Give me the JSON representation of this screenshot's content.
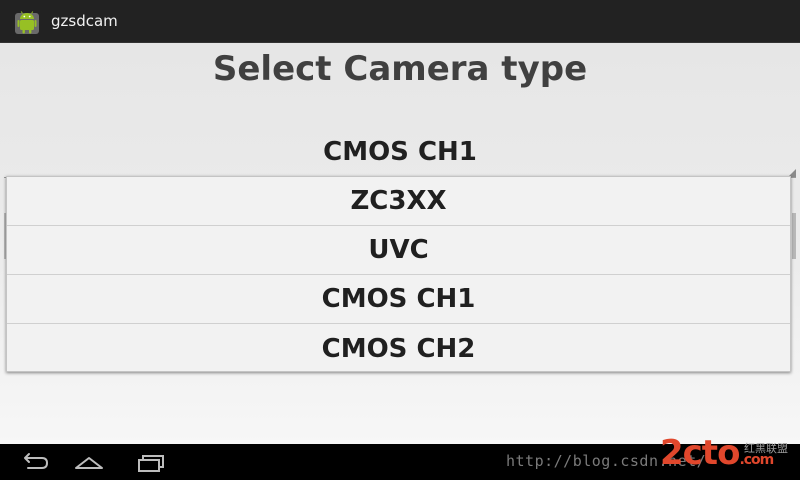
{
  "action_bar": {
    "app_title": "gzsdcam",
    "app_icon": "android-robot-icon"
  },
  "main": {
    "heading": "Select Camera type",
    "spinner": {
      "selected": "CMOS CH1"
    }
  },
  "dropdown": {
    "options": [
      "ZC3XX",
      "UVC",
      "CMOS CH1",
      "CMOS CH2"
    ]
  },
  "nav_bar": {
    "icons": [
      "back-icon",
      "home-icon",
      "recent-apps-icon"
    ]
  },
  "watermark": {
    "url": "http://blog.csdn.net/",
    "logo_main": "2cto",
    "logo_suffix": ".com",
    "logo_cn": "红黑联盟"
  },
  "colors": {
    "accent_logo": "#e0472c",
    "android_green": "#97c024"
  }
}
